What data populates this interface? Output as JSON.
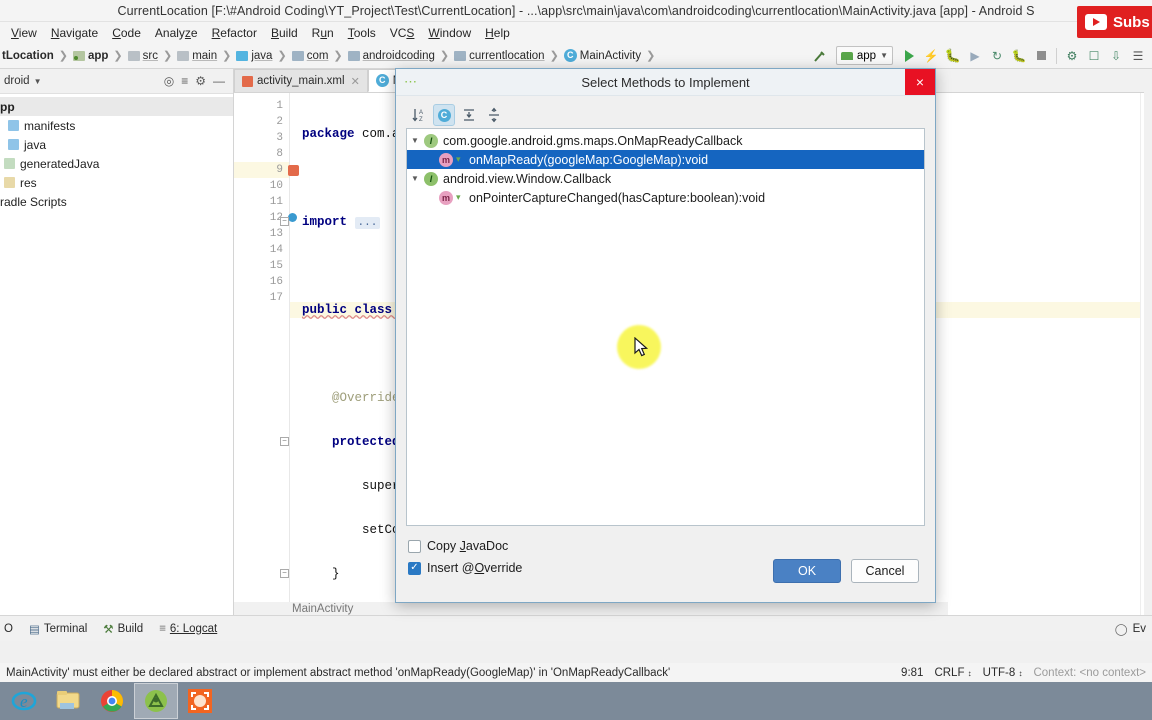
{
  "window": {
    "title": "CurrentLocation [F:\\#Android Coding\\YT_Project\\Test\\CurrentLocation] - ...\\app\\src\\main\\java\\com\\androidcoding\\currentlocation\\MainActivity.java [app] - Android S"
  },
  "menubar": {
    "items": [
      {
        "label": "View",
        "mnemonic": "V"
      },
      {
        "label": "Navigate",
        "mnemonic": "N"
      },
      {
        "label": "Code",
        "mnemonic": "C"
      },
      {
        "label": "Analyze",
        "mnemonic": "z"
      },
      {
        "label": "Refactor",
        "mnemonic": "R"
      },
      {
        "label": "Build",
        "mnemonic": "B"
      },
      {
        "label": "Run",
        "mnemonic": "u"
      },
      {
        "label": "Tools",
        "mnemonic": "T"
      },
      {
        "label": "VCS",
        "mnemonic": "S"
      },
      {
        "label": "Window",
        "mnemonic": "W"
      },
      {
        "label": "Help",
        "mnemonic": "H"
      }
    ]
  },
  "breadcrumb": {
    "items": [
      {
        "label": "tLocation",
        "icon": "project-icon",
        "kind": "project"
      },
      {
        "label": "app",
        "icon": "module-icon",
        "kind": "module"
      },
      {
        "label": "src",
        "icon": "folder-icon",
        "kind": "folder"
      },
      {
        "label": "main",
        "icon": "folder-icon",
        "kind": "folder"
      },
      {
        "label": "java",
        "icon": "source-folder-icon",
        "kind": "source"
      },
      {
        "label": "com",
        "icon": "package-icon",
        "kind": "package"
      },
      {
        "label": "androidcoding",
        "icon": "package-icon",
        "kind": "package"
      },
      {
        "label": "currentlocation",
        "icon": "package-icon",
        "kind": "package"
      },
      {
        "label": "MainActivity",
        "icon": "class-icon",
        "kind": "class"
      }
    ]
  },
  "toolbar": {
    "module": "app",
    "buttons": [
      "build-hammer-icon",
      "run-icon",
      "apply-changes-icon",
      "debug-icon",
      "run-coverage-icon",
      "profiler-icon",
      "attach-debugger-icon",
      "stop-icon",
      "sdk-manager-icon",
      "avd-manager-icon",
      "sync-gradle-icon",
      "more-icon"
    ]
  },
  "project_panel": {
    "title": "droid",
    "tools": [
      "locate-icon",
      "collapse-all-icon",
      "settings-icon",
      "hide-icon"
    ],
    "tree": [
      {
        "label": "pp",
        "type": "module",
        "bold": true
      },
      {
        "label": "manifests",
        "type": "folder"
      },
      {
        "label": "java",
        "type": "folder"
      },
      {
        "label": "generatedJava",
        "type": "generated"
      },
      {
        "label": "res",
        "type": "res"
      },
      {
        "label": "radle Scripts",
        "type": "gradle"
      }
    ]
  },
  "editor": {
    "tabs": [
      {
        "label": "activity_main.xml",
        "icon": "xml-file-icon",
        "active": false
      },
      {
        "label": "M",
        "icon": "java-class-icon",
        "active": true
      }
    ],
    "breadcrumb_footer": "MainActivity",
    "lines": [
      {
        "no": "1",
        "text": "package com.andr"
      },
      {
        "no": "2",
        "text": ""
      },
      {
        "no": "3",
        "text": "import"
      },
      {
        "no": "8",
        "text": ""
      },
      {
        "no": "9",
        "text": "public class Mai"
      },
      {
        "no": "10",
        "text": ""
      },
      {
        "no": "11",
        "text": "    @Override"
      },
      {
        "no": "12",
        "text": "    protected vo"
      },
      {
        "no": "13",
        "text": "        super.on"
      },
      {
        "no": "14",
        "text": "        setConte"
      },
      {
        "no": "15",
        "text": "    }"
      },
      {
        "no": "16",
        "text": "}"
      },
      {
        "no": "17",
        "text": ""
      }
    ],
    "folded_placeholder": "..."
  },
  "dialog": {
    "title": "Select Methods to Implement",
    "close_label": "×",
    "toolbar": [
      {
        "name": "sort-alphabetically-icon",
        "selected": false
      },
      {
        "name": "show-classes-icon",
        "selected": true
      },
      {
        "name": "expand-all-icon",
        "selected": false
      },
      {
        "name": "collapse-all-icon",
        "selected": false
      }
    ],
    "tree": [
      {
        "label": "com.google.android.gms.maps.OnMapReadyCallback",
        "type": "interface",
        "expanded": true,
        "children": [
          {
            "label": "onMapReady(googleMap:GoogleMap):void",
            "type": "method",
            "selected": true
          }
        ]
      },
      {
        "label": "android.view.Window.Callback",
        "type": "interface-annotated",
        "expanded": true,
        "children": [
          {
            "label": "onPointerCaptureChanged(hasCapture:boolean):void",
            "type": "method",
            "selected": false
          }
        ]
      }
    ],
    "options": [
      {
        "label": "Copy JavaDoc",
        "checked": false,
        "mnemonic": "J"
      },
      {
        "label": "Insert @Override",
        "checked": true,
        "mnemonic": "O"
      }
    ],
    "buttons": {
      "ok": "OK",
      "cancel": "Cancel"
    }
  },
  "tool_window_bar": {
    "items": [
      {
        "label": "O",
        "icon": "todo-icon"
      },
      {
        "label": "Terminal",
        "icon": "terminal-icon"
      },
      {
        "label": "Build",
        "icon": "build-icon"
      },
      {
        "label": "6: Logcat",
        "icon": "logcat-icon",
        "mnemonic": "6"
      }
    ],
    "right": [
      {
        "label": "Ev",
        "icon": "event-log-icon"
      }
    ]
  },
  "statusbar": {
    "message": "MainActivity' must either be declared abstract or implement abstract method 'onMapReady(GoogleMap)' in 'OnMapReadyCallback'",
    "caret": "9:81",
    "line_separator": "CRLF",
    "encoding": "UTF-8",
    "context": "Context: <no context>"
  },
  "taskbar": {
    "apps": [
      {
        "name": "internet-explorer-icon",
        "active": false
      },
      {
        "name": "file-explorer-icon",
        "active": false
      },
      {
        "name": "google-chrome-icon",
        "active": false
      },
      {
        "name": "android-studio-icon",
        "active": true
      },
      {
        "name": "vlc-or-app-icon",
        "active": false
      }
    ]
  },
  "overlay": {
    "youtube_subscribe": "Subs"
  },
  "colors": {
    "accent": "#1565c0",
    "dialog_border": "#7ea7c4",
    "primary_button": "#4a81c4",
    "close_red": "#e81123",
    "taskbar": "#7c8a99",
    "cursor_highlight": "#f7f53a",
    "selection": "#1565c0"
  }
}
